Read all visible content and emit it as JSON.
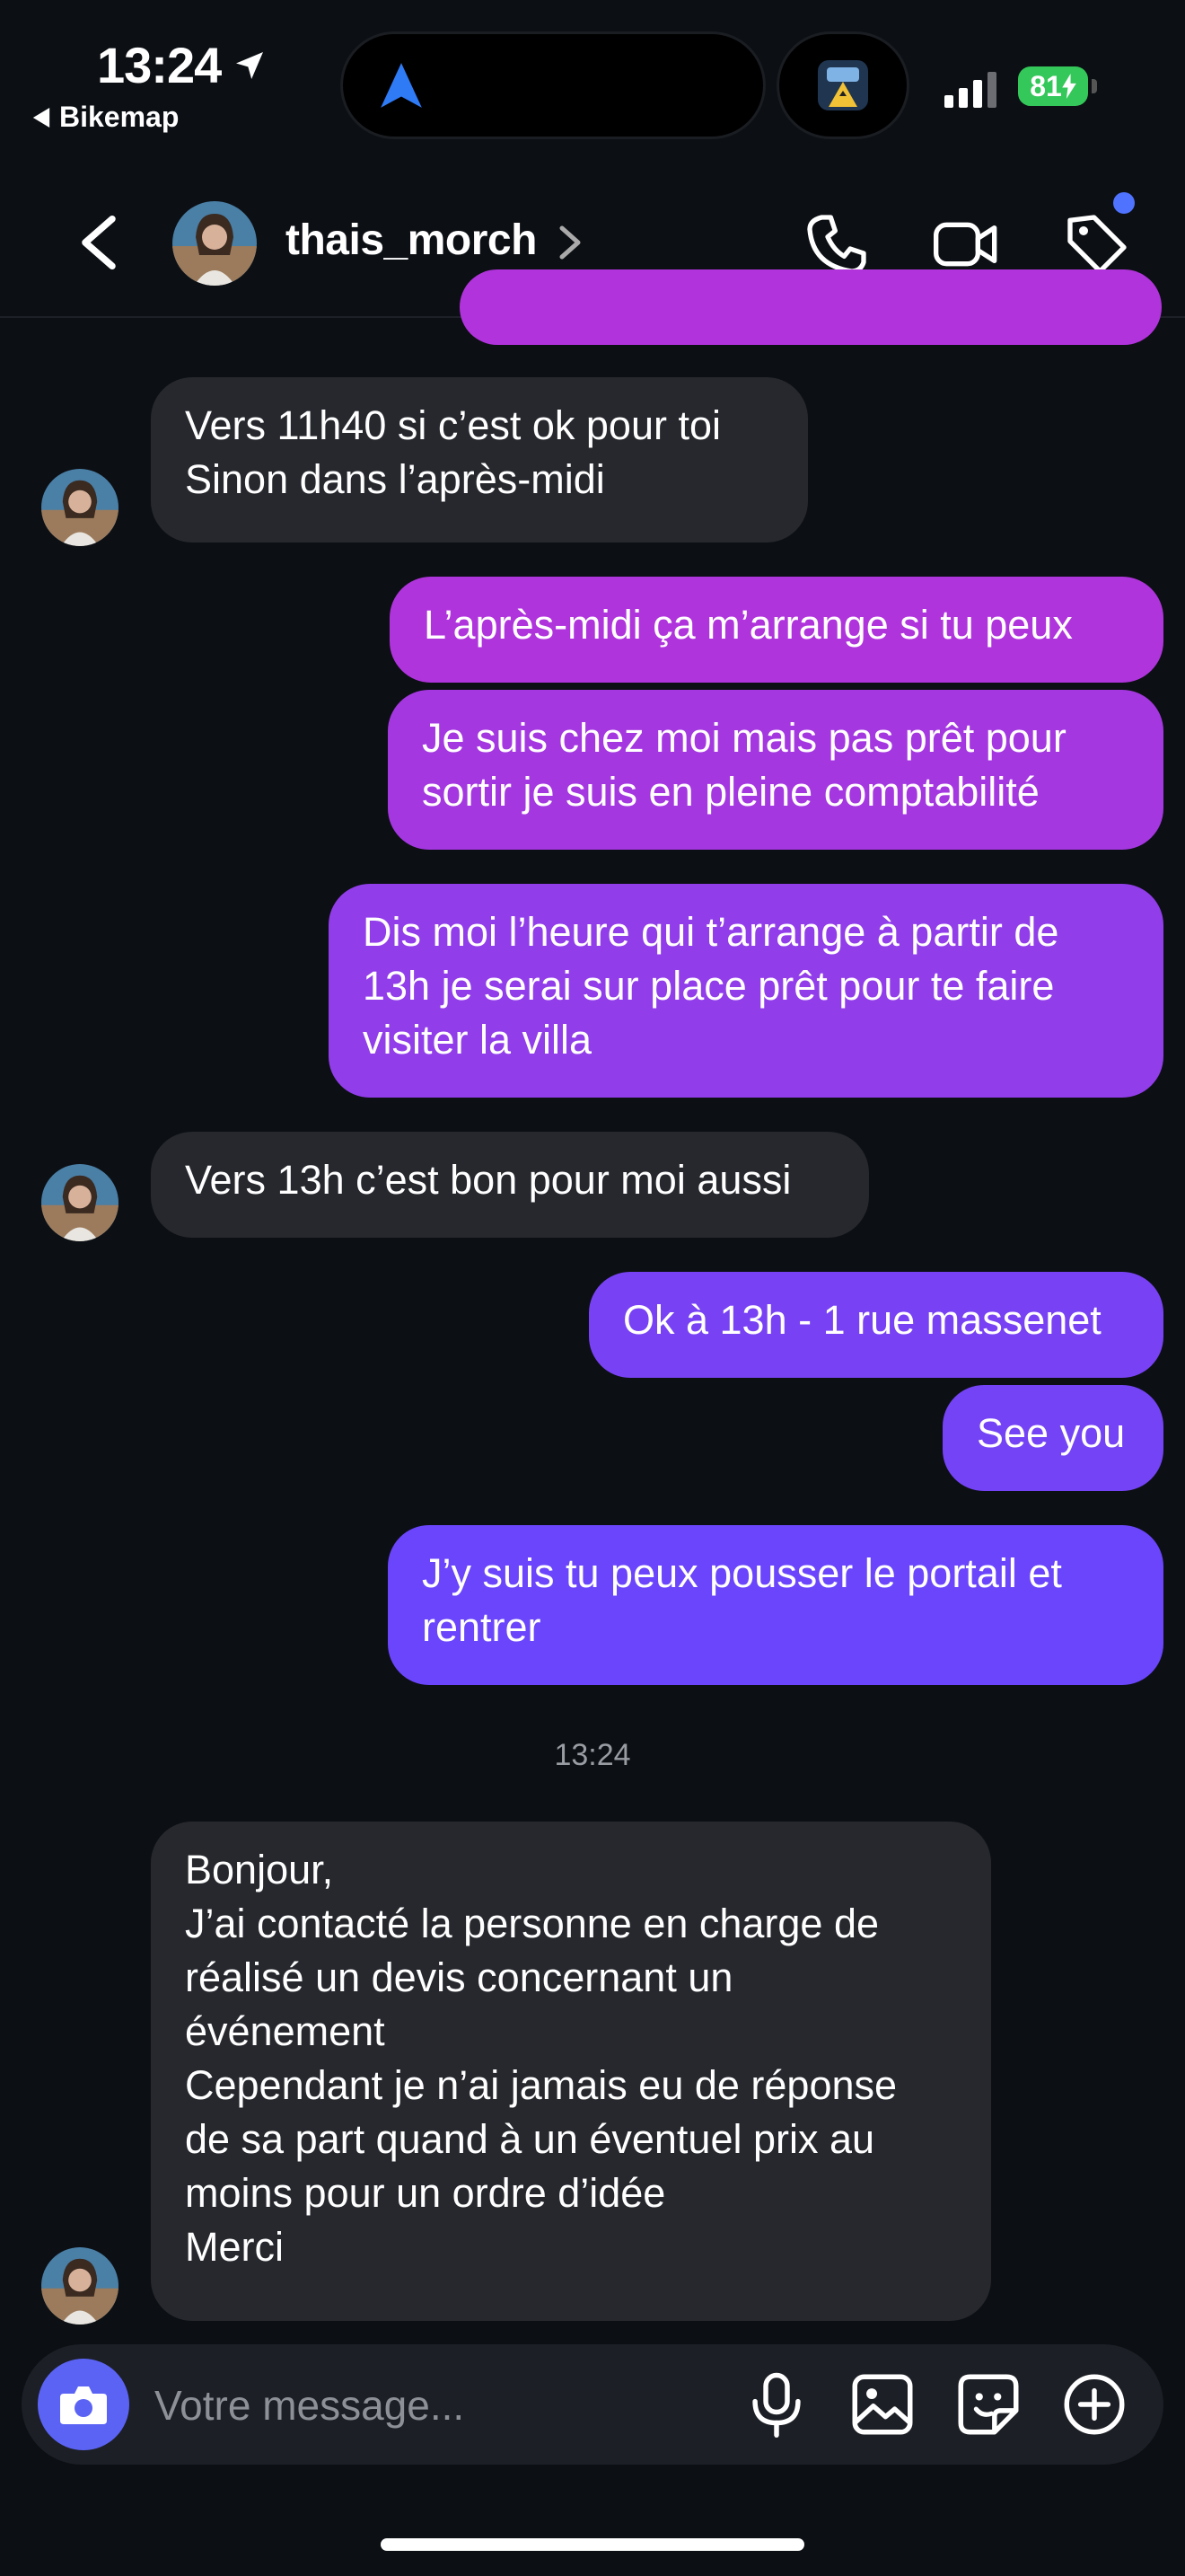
{
  "status_bar": {
    "time": "13:24",
    "back_app": "Bikemap",
    "battery": "81"
  },
  "header": {
    "username": "thais_morch",
    "icons": [
      "back-chevron-icon",
      "phone-icon",
      "video-camera-icon",
      "tag-icon"
    ]
  },
  "messages": [
    {
      "from": "them",
      "text": "Vers 11h40 si c’est ok pour toi\nSinon dans l’après-midi"
    },
    {
      "from": "me",
      "text": "L’après-midi ça m’arrange si tu peux"
    },
    {
      "from": "me",
      "text": "Je suis chez moi mais pas prêt pour\nsortir je suis en pleine comptabilité"
    },
    {
      "from": "me",
      "text": "Dis moi l’heure qui t’arrange à partir de\n13h je serai sur place prêt pour te faire\nvisiter la villa"
    },
    {
      "from": "them",
      "text": "Vers 13h c’est bon pour moi aussi"
    },
    {
      "from": "me",
      "text": "Ok à 13h - 1 rue massenet"
    },
    {
      "from": "me",
      "text": "See you"
    },
    {
      "from": "me",
      "text": "J’y suis tu peux pousser le portail et\nrentrer"
    },
    {
      "from": "them",
      "text": "Bonjour,\nJ’ai contacté la personne en charge de\nréalisé un devis concernant un\névénement\nCependant je n’ai jamais eu de réponse\nde sa part quand à un éventuel prix au\nmoins pour un ordre d’idée\nMerci"
    }
  ],
  "timestamp": "13:24",
  "composer": {
    "placeholder": "Votre message...",
    "icons": [
      "camera-icon",
      "microphone-icon",
      "gallery-icon",
      "sticker-icon",
      "plus-icon"
    ]
  },
  "colors": {
    "background": "#0c0f14",
    "received_bubble": "#26282e",
    "sent_gradient_top": "#b133db",
    "sent_gradient_bottom": "#6a45fb",
    "accent": "#5b63f5"
  }
}
